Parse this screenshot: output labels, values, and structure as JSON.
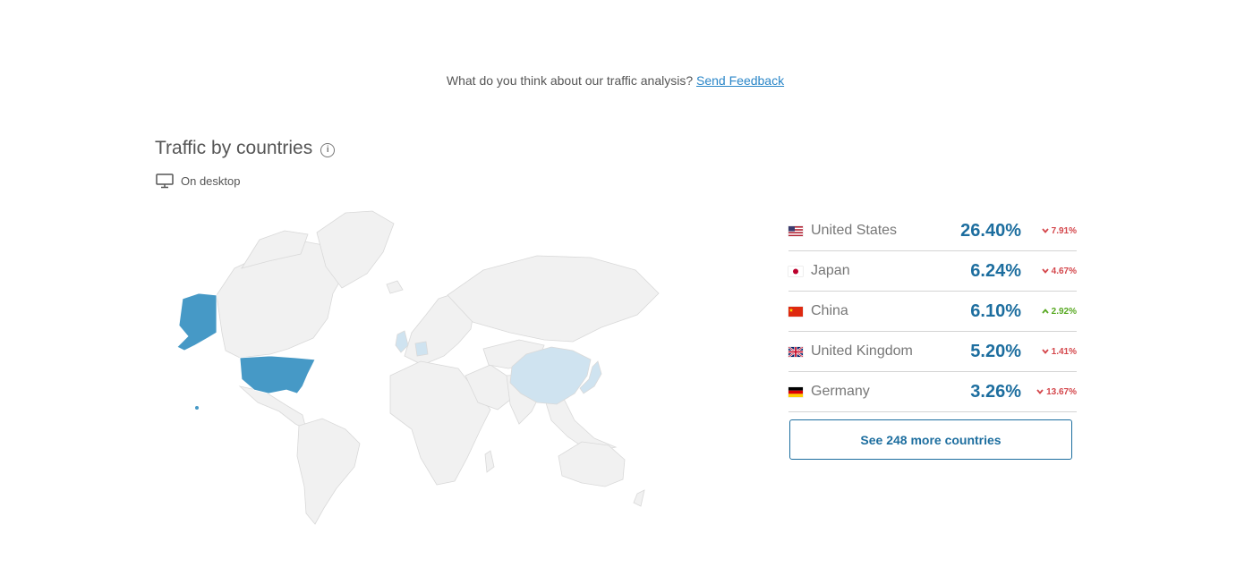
{
  "feedback": {
    "question": "What do you think about our traffic analysis?",
    "link": "Send Feedback"
  },
  "section": {
    "title": "Traffic by countries",
    "device_label": "On desktop"
  },
  "colors": {
    "accent": "#1d6e9f",
    "map_high": "#4699c6",
    "map_mid": "#cfe3f0",
    "map_low": "#f1f1f1",
    "down": "#d4464b",
    "up": "#57a821"
  },
  "countries": [
    {
      "name": "United States",
      "share": "26.40%",
      "change": "7.91%",
      "direction": "down",
      "flag": "us-flag-icon"
    },
    {
      "name": "Japan",
      "share": "6.24%",
      "change": "4.67%",
      "direction": "down",
      "flag": "jp-flag-icon"
    },
    {
      "name": "China",
      "share": "6.10%",
      "change": "2.92%",
      "direction": "up",
      "flag": "cn-flag-icon"
    },
    {
      "name": "United Kingdom",
      "share": "5.20%",
      "change": "1.41%",
      "direction": "down",
      "flag": "gb-flag-icon"
    },
    {
      "name": "Germany",
      "share": "3.26%",
      "change": "13.67%",
      "direction": "down",
      "flag": "de-flag-icon"
    }
  ],
  "more_button": "See 248 more countries"
}
